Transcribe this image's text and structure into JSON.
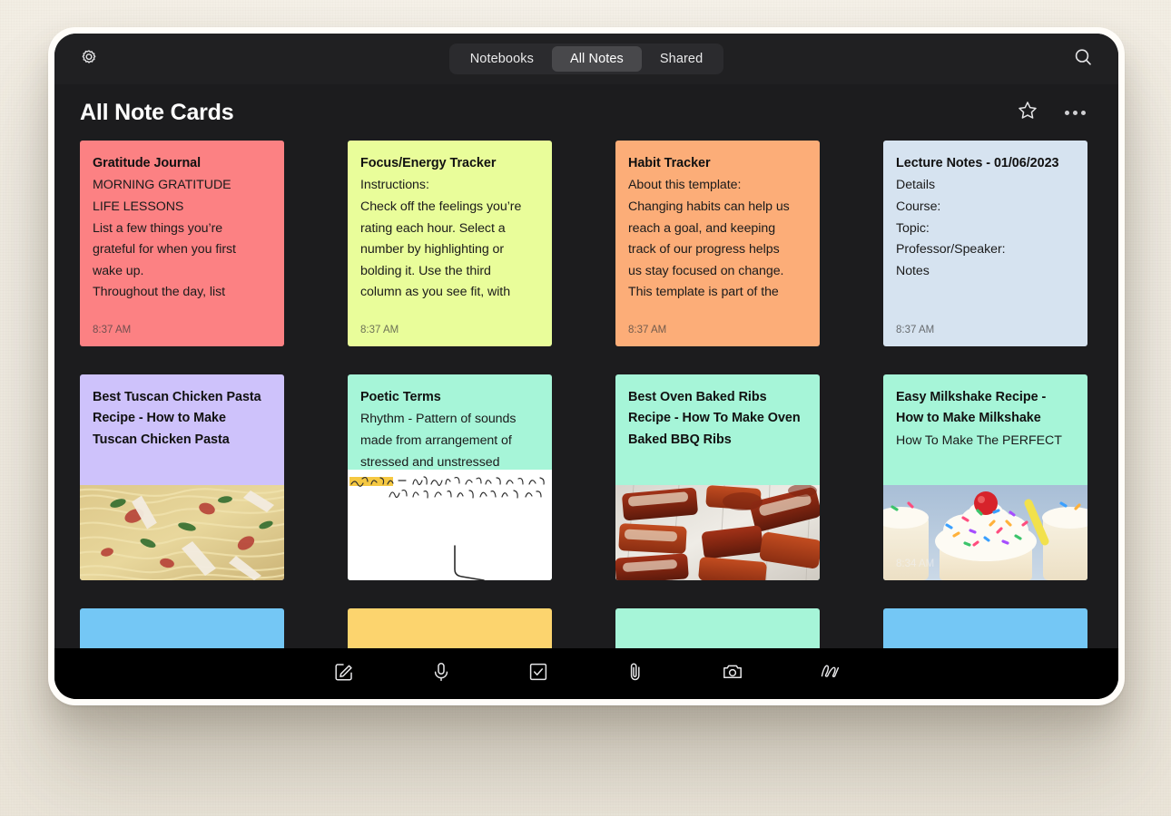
{
  "topbar": {
    "gear_icon": "gear-icon",
    "search_icon": "search-icon",
    "tabs": [
      {
        "label": "Notebooks",
        "active": false
      },
      {
        "label": "All Notes",
        "active": true
      },
      {
        "label": "Shared",
        "active": false
      }
    ]
  },
  "header": {
    "title": "All Note Cards",
    "star_icon": "star-icon",
    "more_icon": "more-options-icon"
  },
  "cards": [
    {
      "title": "Gratitude Journal",
      "lines": [
        "MORNING GRATITUDE",
        "LIFE LESSONS",
        "List a few things you’re",
        "grateful for when you first",
        "wake up.",
        "Throughout the day, list"
      ],
      "time": "8:37 AM",
      "color": "#FC8183",
      "thumb": "none"
    },
    {
      "title": "Focus/Energy Tracker",
      "lines": [
        "Instructions:",
        "Check off the feelings you’re",
        "rating each hour. Select a",
        "number by highlighting or",
        "bolding it. Use the third",
        "column as you see fit, with"
      ],
      "time": "8:37 AM",
      "color": "#E9FD9A",
      "thumb": "none"
    },
    {
      "title": "Habit Tracker",
      "lines": [
        "About this template:",
        "Changing habits can help us",
        "reach a goal, and keeping",
        "track of our progress helps",
        "us stay focused on change.",
        "This template is part of the"
      ],
      "time": "8:37 AM",
      "color": "#FCAD78",
      "thumb": "none"
    },
    {
      "title": "Lecture Notes - 01/06/2023",
      "lines": [
        "Details",
        "Course:",
        "Topic:",
        "Professor/Speaker:",
        "Notes"
      ],
      "time": "8:37 AM",
      "color": "#D6E3F0",
      "thumb": "none"
    },
    {
      "title": "Best Tuscan Chicken Pasta Recipe - How to Make Tuscan Chicken Pasta",
      "lines": [],
      "time": "",
      "color": "#CEC2FB",
      "thumb": "pasta"
    },
    {
      "title": "Poetic Terms",
      "lines": [
        "Rhythm - Pattern of sounds",
        "made from arrangement of",
        "stressed and unstressed"
      ],
      "time": "",
      "color": "#A6F5D8",
      "thumb": "handwriting"
    },
    {
      "title": "Best Oven Baked Ribs Recipe - How To Make Oven Baked BBQ Ribs",
      "lines": [],
      "time": "",
      "color": "#A6F5D8",
      "thumb": "ribs"
    },
    {
      "title": "Easy Milkshake Recipe - How to Make Milkshake",
      "lines": [
        "",
        "How To Make The PERFECT"
      ],
      "time": "8:34 AM",
      "color": "#A6F5D8",
      "thumb": "milkshake"
    },
    {
      "title": "",
      "lines": [],
      "time": "",
      "color": "#74C7F5",
      "thumb": "none"
    },
    {
      "title": "",
      "lines": [],
      "time": "",
      "color": "#FCD46E",
      "thumb": "none"
    },
    {
      "title": "",
      "lines": [],
      "time": "",
      "color": "#A6F5D8",
      "thumb": "none"
    },
    {
      "title": "",
      "lines": [],
      "time": "",
      "color": "#74C7F5",
      "thumb": "none"
    }
  ],
  "dock": {
    "items": [
      {
        "icon": "compose-icon",
        "label": "Compose"
      },
      {
        "icon": "microphone-icon",
        "label": "Audio"
      },
      {
        "icon": "checkbox-icon",
        "label": "Checklist"
      },
      {
        "icon": "paperclip-icon",
        "label": "Attach"
      },
      {
        "icon": "camera-icon",
        "label": "Camera"
      },
      {
        "icon": "scribble-icon",
        "label": "Scribble"
      }
    ]
  }
}
